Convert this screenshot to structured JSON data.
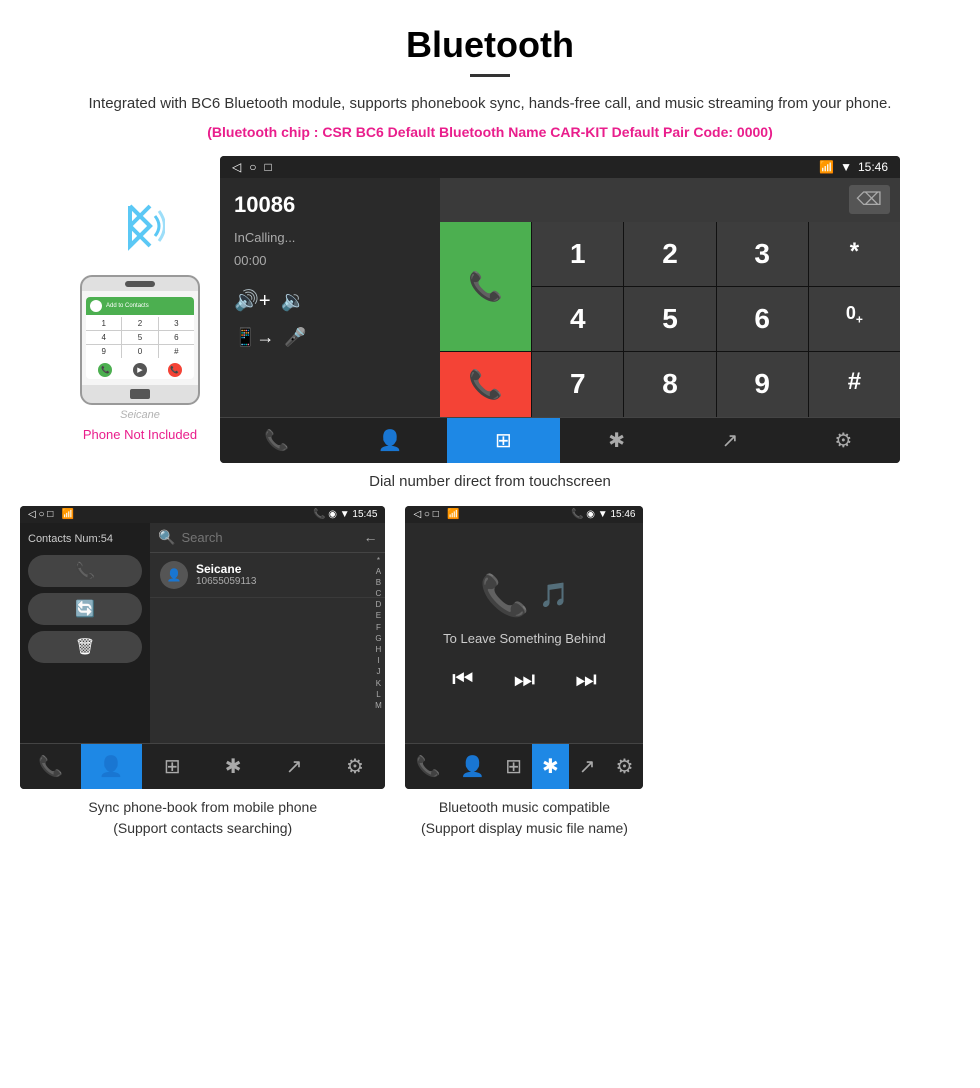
{
  "header": {
    "title": "Bluetooth",
    "description": "Integrated with BC6 Bluetooth module, supports phonebook sync, hands-free call, and music streaming from your phone.",
    "specs": "(Bluetooth chip : CSR BC6    Default Bluetooth Name CAR-KIT    Default Pair Code: 0000)"
  },
  "phone_mockup": {
    "not_included_label": "Phone Not Included",
    "top_bar_text": "Add to Contacts",
    "keys": [
      "1",
      "2",
      "3",
      "4",
      "5",
      "6",
      "*",
      "0",
      "#"
    ]
  },
  "dial_screen": {
    "statusbar": {
      "left": [
        "◁",
        "○",
        "□"
      ],
      "icons": "📞 ◉ ▼",
      "time": "15:46"
    },
    "number": "10086",
    "status": "InCalling...",
    "timer": "00:00",
    "keypad": {
      "rows": [
        [
          "1",
          "2",
          "3",
          "*",
          "📞"
        ],
        [
          "4",
          "5",
          "6",
          "0+",
          ""
        ],
        [
          "7",
          "8",
          "9",
          "#",
          "📞"
        ]
      ],
      "keys": [
        "1",
        "2",
        "3",
        "*",
        "4",
        "5",
        "6",
        "0+",
        "7",
        "8",
        "9",
        "#"
      ]
    },
    "nav_items": [
      "📞↔",
      "👤",
      "⊞",
      "𝄞*",
      "↗",
      "⚙"
    ]
  },
  "main_caption": "Dial number direct from touchscreen",
  "contacts_screen": {
    "statusbar": {
      "left": "◁ ○ □  📶",
      "right": "📞 ◉ ▼ 15:45"
    },
    "contacts_num": "Contacts Num:54",
    "search_placeholder": "Search",
    "contact": {
      "name": "Seicane",
      "number": "10655059113"
    },
    "alpha": [
      "*",
      "A",
      "B",
      "C",
      "D",
      "E",
      "F",
      "G",
      "H",
      "I",
      "J",
      "K",
      "L",
      "M"
    ],
    "nav_items": [
      "📞↔",
      "👤",
      "⊞",
      "𝄞*",
      "↗",
      "⚙"
    ]
  },
  "contacts_caption": {
    "line1": "Sync phone-book from mobile phone",
    "line2": "(Support contacts searching)"
  },
  "music_screen": {
    "statusbar": {
      "left": "◁ ○ □  📶",
      "right": "📞 ◉ ▼ 15:46"
    },
    "song_title": "To Leave Something Behind",
    "nav_items": [
      "📞↔",
      "👤",
      "⊞",
      "𝄞*",
      "↗",
      "⚙"
    ]
  },
  "music_caption": {
    "line1": "Bluetooth music compatible",
    "line2": "(Support display music file name)"
  }
}
